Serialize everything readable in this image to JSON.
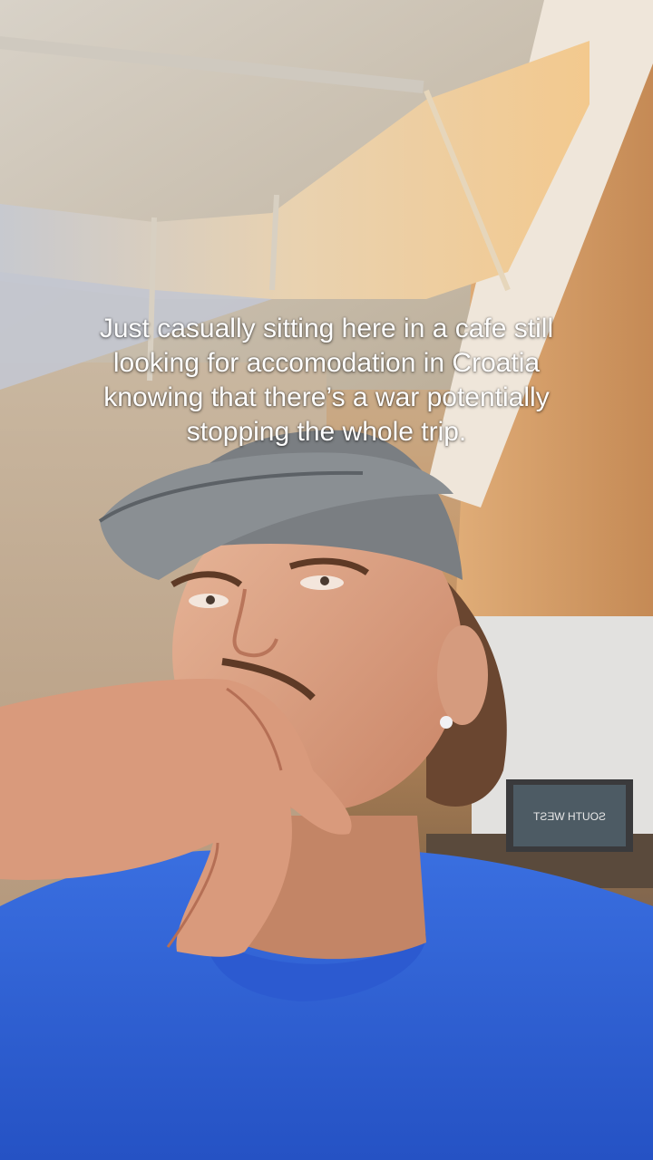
{
  "caption": {
    "lines": [
      "Just casually sitting here in a cafe still",
      "looking for accomodation in Croatia",
      "knowing that there’s a war potentially",
      "stopping the whole trip."
    ]
  },
  "poster": {
    "text": "SOUTH WEST"
  },
  "colors": {
    "shirt": "#2f63d8",
    "wall_warm": "#d8a672",
    "ceiling": "#d9d2c6",
    "cap": "#6e7378"
  }
}
